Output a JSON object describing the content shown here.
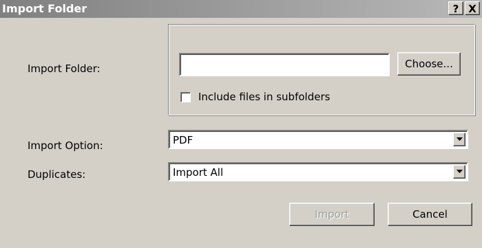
{
  "window": {
    "title": "Import Folder",
    "help_label": "?",
    "close_label": "X"
  },
  "form": {
    "import_folder_label": "Import Folder:",
    "folder_path_value": "",
    "choose_button": "Choose...",
    "include_subfolders_label": "Include files in subfolders",
    "include_subfolders_checked": false,
    "import_option_label": "Import Option:",
    "import_option_value": "PDF",
    "duplicates_label": "Duplicates:",
    "duplicates_value": "Import All"
  },
  "buttons": {
    "import": "Import",
    "import_enabled": false,
    "cancel": "Cancel"
  },
  "icons": {
    "dropdown": "chevron-down-icon"
  },
  "colors": {
    "face": "#d4d0c8",
    "title_start": "#808080",
    "title_end": "#b8b8b8"
  }
}
